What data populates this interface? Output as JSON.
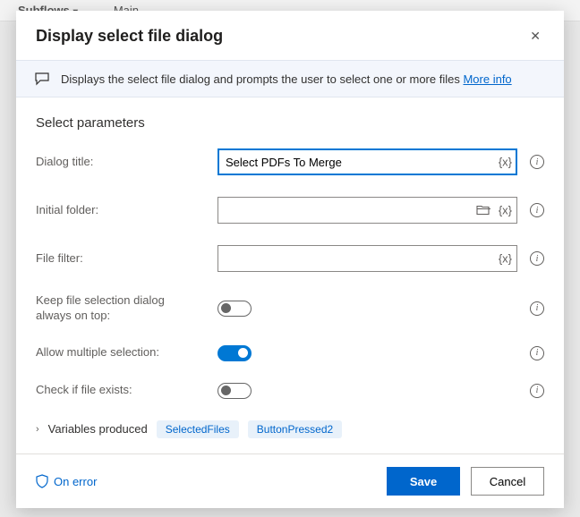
{
  "bg": {
    "subflows": "Subflows",
    "main": "Main"
  },
  "dialog": {
    "title": "Display select file dialog",
    "description": "Displays the select file dialog and prompts the user to select one or more files",
    "more_info": "More info",
    "section": "Select parameters",
    "fields": {
      "dialog_title": {
        "label": "Dialog title:",
        "value": "Select PDFs To Merge"
      },
      "initial_folder": {
        "label": "Initial folder:",
        "value": ""
      },
      "file_filter": {
        "label": "File filter:",
        "value": ""
      },
      "keep_on_top": {
        "label": "Keep file selection dialog always on top:"
      },
      "allow_multiple": {
        "label": "Allow multiple selection:"
      },
      "check_exists": {
        "label": "Check if file exists:"
      }
    },
    "vars": {
      "label": "Variables produced",
      "v1": "SelectedFiles",
      "v2": "ButtonPressed2"
    },
    "footer": {
      "on_error": "On error",
      "save": "Save",
      "cancel": "Cancel"
    }
  }
}
